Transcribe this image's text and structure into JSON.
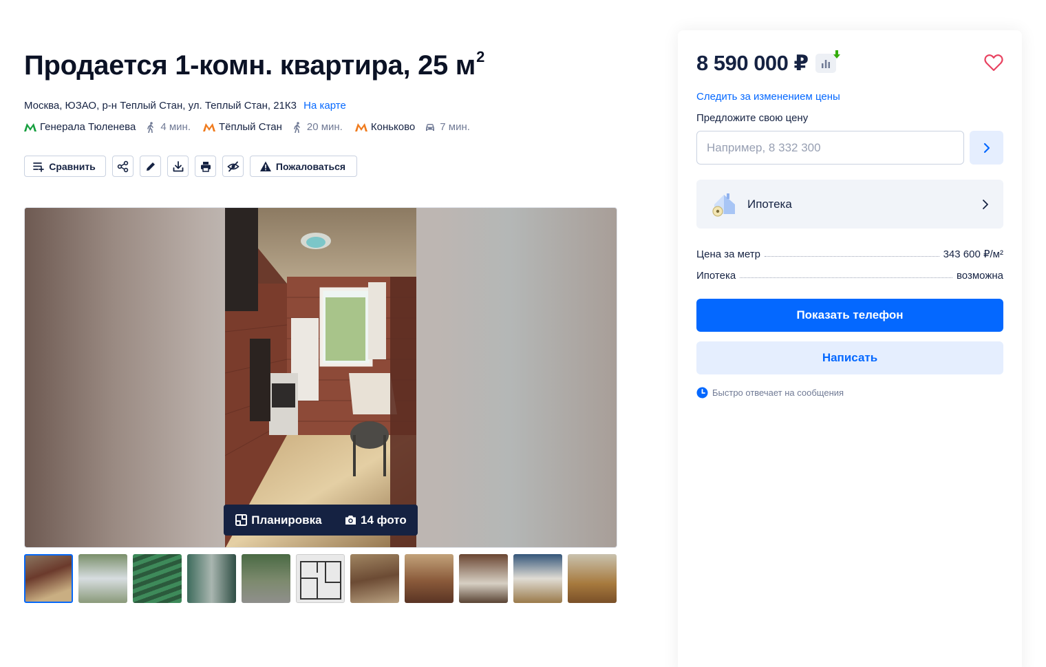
{
  "listing": {
    "title": "Продается 1-комн. квартира, 25 м",
    "title_sup": "2",
    "address": "Москва, ЮЗАО, р-н Теплый Стан, ул. Теплый Стан, 21К3",
    "map_link": "На карте",
    "metro": [
      {
        "name": "Генерала Тюленева",
        "time": "4 мин.",
        "transport": "walk-icon",
        "color": "#169f3f"
      },
      {
        "name": "Тёплый Стан",
        "time": "20 мин.",
        "transport": "walk-icon",
        "color": "#f07b1d"
      },
      {
        "name": "Коньково",
        "time": "7 мин.",
        "transport": "car-icon",
        "color": "#f07b1d"
      }
    ]
  },
  "actions": {
    "compare": "Сравнить",
    "report": "Пожаловаться",
    "icons": [
      "compare-icon",
      "share-icon",
      "edit-icon",
      "download-icon",
      "print-icon",
      "hide-icon",
      "warning-icon"
    ]
  },
  "gallery": {
    "layout_label": "Планировка",
    "photos_label": "14 фото",
    "thumb_count": 11,
    "active_thumb": 0
  },
  "sidebar": {
    "price": "8 590 000 ₽",
    "track_price": "Следить за изменением цены",
    "offer_label": "Предложите свою цену",
    "offer_placeholder": "Например, 8 332 300",
    "mortgage_label": "Ипотека",
    "info": [
      {
        "label": "Цена за метр",
        "value": "343 600 ₽/м²"
      },
      {
        "label": "Ипотека",
        "value": "возможна"
      }
    ],
    "show_phone": "Показать телефон",
    "write": "Написать",
    "quick_reply": "Быстро отвечает на сообщения"
  },
  "colors": {
    "accent": "#0468ff",
    "text": "#152242",
    "muted": "#707a95",
    "favorite": "#e84260",
    "price_down": "#34ac0a"
  }
}
